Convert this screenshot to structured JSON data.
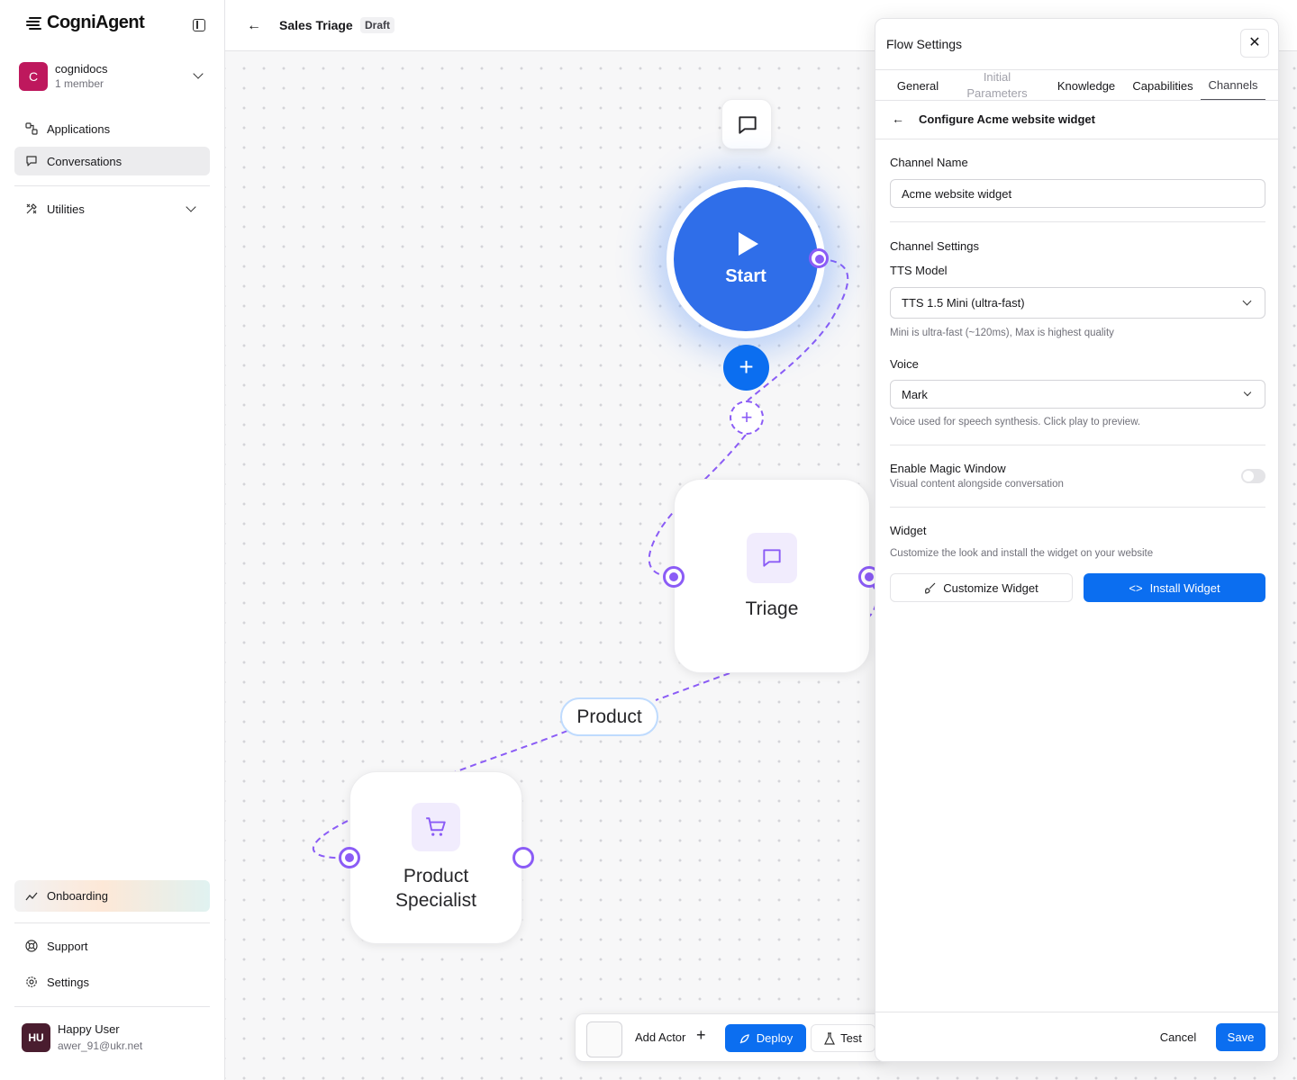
{
  "app": {
    "brand": "CogniAgent"
  },
  "org": {
    "avatar_letter": "C",
    "name": "cognidocs",
    "members": "1 member"
  },
  "sidebar": {
    "items": [
      {
        "label": "Applications",
        "icon": "applications-icon"
      },
      {
        "label": "Conversations",
        "icon": "chat-icon"
      },
      {
        "label": "Utilities",
        "icon": "tools-icon"
      }
    ],
    "onboarding": "Onboarding",
    "support": "Support",
    "settings": "Settings"
  },
  "user": {
    "initials": "HU",
    "name": "Happy User",
    "email": "awer_91@ukr.net"
  },
  "header": {
    "title": "Sales Triage",
    "badge": "Draft"
  },
  "canvas": {
    "start_label": "Start",
    "triage_label": "Triage",
    "product_specialist_label": "Product Specialist",
    "edge_label": "Product"
  },
  "toolbar": {
    "add_actor": "Add Actor",
    "deploy": "Deploy",
    "test": "Test"
  },
  "panel": {
    "title": "Flow Settings",
    "tabs": [
      {
        "label": "General"
      },
      {
        "label": "Initial Parameters"
      },
      {
        "label": "Knowledge"
      },
      {
        "label": "Capabilities"
      },
      {
        "label": "Channels"
      }
    ],
    "active_tab": "Channels",
    "sub_title": "Configure Acme website widget",
    "channel_name_label": "Channel Name",
    "channel_name_value": "Acme website widget",
    "channel_settings_label": "Channel Settings",
    "tts_label": "TTS Model",
    "tts_value": "TTS 1.5 Mini (ultra-fast)",
    "tts_help": "Mini is ultra-fast (~120ms), Max is highest quality",
    "voice_label": "Voice",
    "voice_value": "Mark",
    "voice_help": "Voice used for speech synthesis. Click play to preview.",
    "magic_label": "Enable Magic Window",
    "magic_help": "Visual content alongside conversation",
    "magic_enabled": false,
    "widget_label": "Widget",
    "widget_help": "Customize the look and install the widget on your website",
    "customize_btn": "Customize Widget",
    "install_btn": "Install Widget",
    "cancel": "Cancel",
    "save": "Save"
  },
  "colors": {
    "accent": "#0b6ef0",
    "edge": "#8b5cf6",
    "start": "#2f6ee9",
    "org": "#be185d"
  }
}
